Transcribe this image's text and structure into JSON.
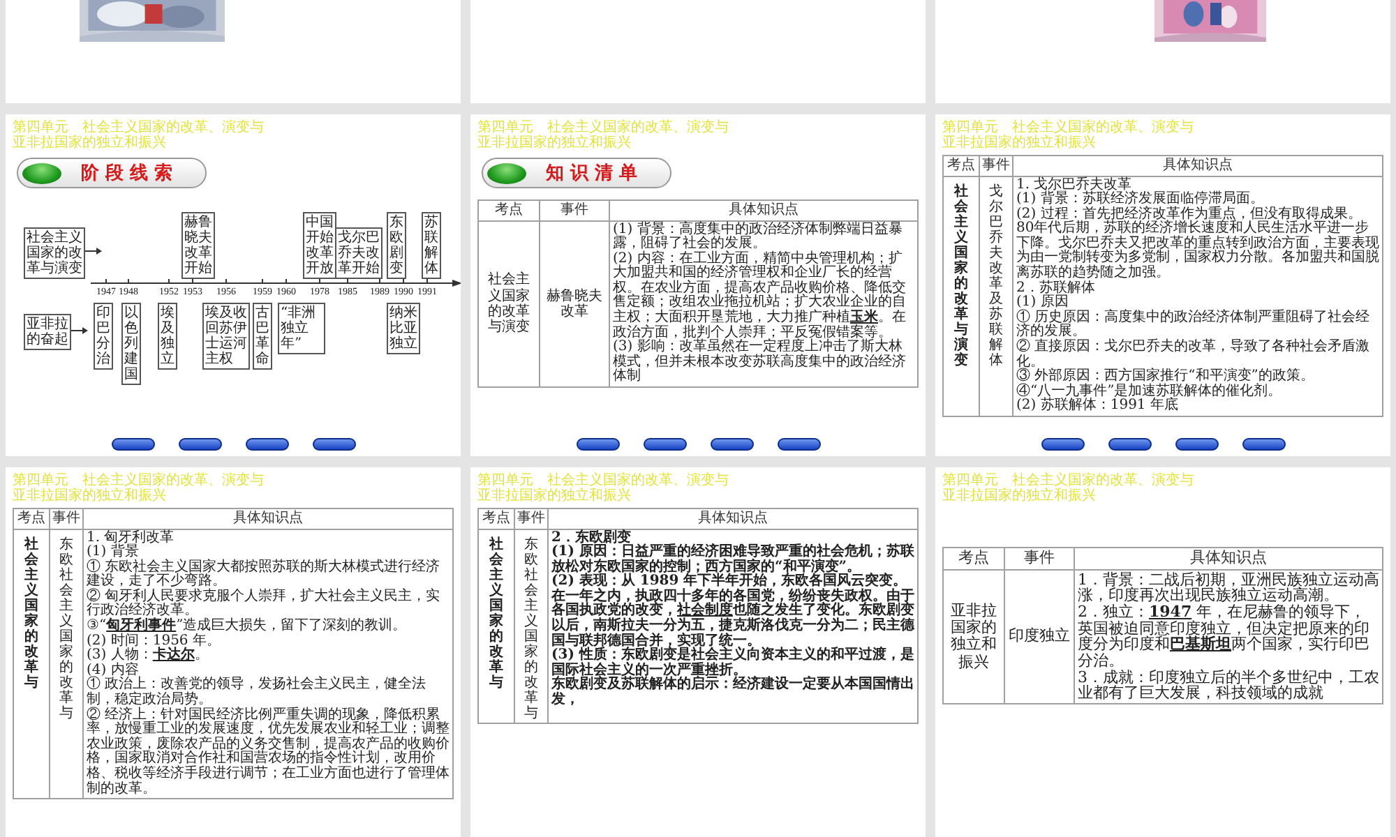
{
  "slides": [
    {
      "kind": "picture"
    },
    {
      "kind": "blank"
    },
    {
      "kind": "picture"
    },
    {
      "kind": "timeline",
      "unit": [
        "第四单元　社会主义国家的改革、演变与",
        "亚非拉国家的独立和振兴"
      ],
      "banner": "阶 段 线 索",
      "categories": [
        "社会主义国家的改革与演变",
        "亚非拉的奋起"
      ],
      "years": [
        "1947",
        "1948",
        "1952",
        "1953",
        "1956",
        "1959",
        "1960",
        "1978",
        "1985",
        "1989",
        "1990",
        "1991"
      ],
      "top_events": [
        "赫鲁晓夫改革开始",
        "中国开始改革开放",
        "戈尔巴乔夫改革开始",
        "东欧剧变",
        "苏联解体"
      ],
      "bottom_events": [
        "印巴分治",
        "以色列建国",
        "埃及独立",
        "埃及收回苏伊士运河主权",
        "古巴革命",
        "“非洲独立年”",
        "纳米比亚独立"
      ],
      "nav": true
    },
    {
      "kind": "table",
      "unit": [
        "第四单元　社会主义国家的改革、演变与",
        "亚非拉国家的独立和振兴"
      ],
      "banner": "知 识 清 单",
      "vertical": false,
      "topic_bold": false,
      "content_bold": false,
      "headers": [
        "考点",
        "事件",
        "具体知识点"
      ],
      "row": {
        "topic": "社会主义国家的改革与演变",
        "event": "赫鲁晓夫改革",
        "points": [
          "(1) 背景：高度集中的政治经济体制弊端日益暴露，阻碍了社会的发展。",
          "(2) 内容：在工业方面，精简中央管理机构；扩大加盟共和国的经济管理权和企业厂长的经营权。在农业方面，提高农产品收购价格、降低交售定额；改组农业拖拉机站；扩大农业企业的自主权；大面积开垦荒地，大力推广种植**玉米**。在政治方面，批判个人崇拜；平反冤假错案等。",
          "(3) 影响：改革虽然在一定程度上冲击了斯大林模式，但并未根本改变苏联高度集中的政治经济体制"
        ]
      },
      "nav": true
    },
    {
      "kind": "table",
      "unit": [
        "第四单元　社会主义国家的改革、演变与",
        "亚非拉国家的独立和振兴"
      ],
      "vertical": true,
      "topic_bold": true,
      "content_bold": false,
      "headers": [
        "考点",
        "事件",
        "具体知识点"
      ],
      "row": {
        "topic": "社会主义国家的改革与演变",
        "event": "戈尔巴乔夫改革及苏联解体",
        "points": [
          "1. 戈尔巴乔夫改革",
          "(1) 背景：苏联经济发展面临停滞局面。",
          "(2) 过程：首先把经济改革作为重点，但没有取得成果。80年代后期，苏联的经济增长速度和人民生活水平进一步下降。戈尔巴乔夫又把改革的重点转到政治方面，主要表现为由一党制转变为多党制，国家权力分散。各加盟共和国脱离苏联的趋势随之加强。",
          "2．苏联解体",
          "(1) 原因",
          "① 历史原因：高度集中的政治经济体制严重阻碍了社会经济的发展。",
          "② 直接原因：戈尔巴乔夫的改革，导致了各种社会矛盾激化。",
          "③ 外部原因：西方国家推行“和平演变”的政策。",
          "④“八一九事件”是加速苏联解体的催化剂。",
          "(2) 苏联解体：1991 年底"
        ]
      },
      "nav": true
    },
    {
      "kind": "table",
      "unit": [
        "第四单元　社会主义国家的改革、演变与",
        "亚非拉国家的独立和振兴"
      ],
      "vertical": true,
      "topic_bold": true,
      "content_bold": false,
      "headers": [
        "考点",
        "事件",
        "具体知识点"
      ],
      "row": {
        "topic": "社会主义国家的改革与",
        "event": "东欧社会主义国家的改革与",
        "points": [
          "1. 匈牙利改革",
          "(1) 背景",
          "① 东欧社会主义国家大都按照苏联的斯大林模式进行经济建设，走了不少弯路。",
          "② 匈牙利人民要求克服个人崇拜，扩大社会主义民主，实行政治经济改革。",
          "③“**匈牙利事件**”造成巨大损失，留下了深刻的教训。",
          "(2) 时间：1956 年。",
          "(3) 人物：**卡达尔**。",
          "(4) 内容",
          "① 政治上：改善党的领导，发扬社会主义民主，健全法制，稳定政治局势。",
          "② 经济上：针对国民经济比例严重失调的现象，降低积累率，放慢重工业的发展速度，优先发展农业和轻工业；调整农业政策，废除农产品的义务交售制，提高农产品的收购价格，国家取消对合作社和国营农场的指令性计划，改用价格、税收等经济手段进行调节；在工业方面也进行了管理体制的改革。"
        ]
      },
      "nav": false
    },
    {
      "kind": "table",
      "unit": [
        "第四单元　社会主义国家的改革、演变与",
        "亚非拉国家的独立和振兴"
      ],
      "vertical": true,
      "topic_bold": true,
      "content_bold": true,
      "headers": [
        "考点",
        "事件",
        "具体知识点"
      ],
      "row": {
        "topic": "社会主义国家的改革与",
        "event": "东欧社会主义国家的改革与",
        "points": [
          "2．东欧剧变",
          "(1) 原因：日益严重的经济困难导致严重的社会危机；苏联放松对东欧国家的控制；西方国家的“和平演变”。",
          "(2) 表现：从 1989 年下半年开始，东欧各国风云突变。在一年之内，执政四十多年的各国党，纷纷丧失政权。由于各国执政党的改变，**社会制度**也随之发生了变化。东欧剧变以后，南斯拉夫一分为五，捷克斯洛伐克一分为二；民主德国与联邦德国合并，实现了统一。",
          "(3) 性质：东欧剧变是社会主义向资本主义的和平过渡，是国际社会主义的一次严重挫折。",
          "东欧剧变及苏联解体的启示：经济建设一定要从本国国情出发，"
        ]
      },
      "nav": false
    },
    {
      "kind": "table",
      "unit": [
        "第四单元　社会主义国家的改革、演变与",
        "亚非拉国家的独立和振兴"
      ],
      "vertical": false,
      "topic_bold": false,
      "content_bold": false,
      "large": true,
      "headers": [
        "考点",
        "事件",
        "具体知识点"
      ],
      "row": {
        "topic": "亚非拉国家的独立和振兴",
        "event": "印度独立",
        "points": [
          "1．背景：二战后初期，亚洲民族独立运动高涨，印度再次出现民族独立运动高潮。",
          "2．独立：**1947** 年，在尼赫鲁的领导下，英国被迫同意印度独立，但决定把原来的印度分为印度和**巴基斯坦**两个国家，实行印巴分治。",
          "3．成就：印度独立后的半个多世纪中，工农业都有了巨大发展，科技领域的成就"
        ]
      },
      "nav": false
    }
  ]
}
